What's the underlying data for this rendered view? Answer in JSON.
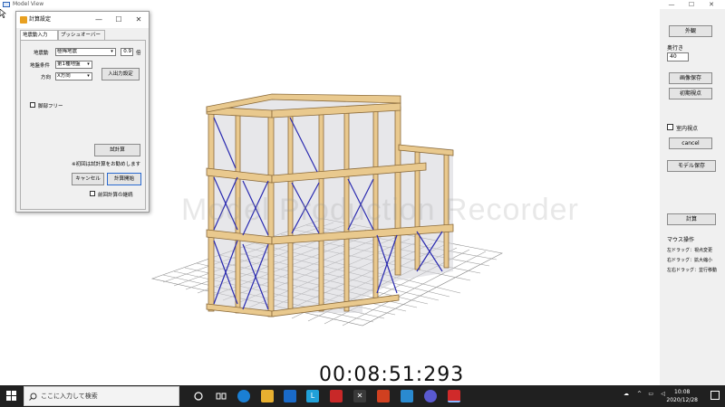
{
  "window": {
    "title": "Model View",
    "ctrl_min": "—",
    "ctrl_max": "☐",
    "ctrl_close": "✕"
  },
  "watermark": "Model Production Recorder",
  "timer": "00:08:51:293",
  "right_panel": {
    "btn_exterior": "外観",
    "depth_label": "奥行き",
    "depth_value": "40",
    "btn_save_image": "画像保存",
    "btn_initial_view": "初期視点",
    "indoor_view_label": "室内視点",
    "btn_cancel": "cancel",
    "btn_save_model": "モデル保存",
    "btn_calc": "計算",
    "mouse_title": "マウス操作",
    "mouse_left": "左ドラッグ：視点変更",
    "mouse_right": "右ドラッグ：拡大縮小",
    "mouse_both": "左右ドラッグ：並行移動"
  },
  "dialog": {
    "title": "計算設定",
    "ctrl_min": "—",
    "ctrl_max": "☐",
    "ctrl_close": "✕",
    "tabs": [
      "地震動入力",
      "プッシュオーバー"
    ],
    "quake_label": "地震動",
    "quake_value": "極稀地震",
    "factor_value": "0.9",
    "factor_unit": "倍",
    "ground_label": "地盤条件",
    "ground_value": "第1種地盤",
    "direction_label": "方向",
    "direction_value": "X方向",
    "btn_io_settings": "入出力設定",
    "joint_free_label": "脚部フリー",
    "btn_trial_calc": "試計算",
    "note": "※初回は試計算をお勧めします",
    "btn_cancel": "キャンセル",
    "btn_start": "計算開始",
    "continue_label": "前回計算の継続"
  },
  "taskbar": {
    "search_placeholder": "ここに入力して検索",
    "time": "10:08",
    "date": "2020/12/28"
  }
}
